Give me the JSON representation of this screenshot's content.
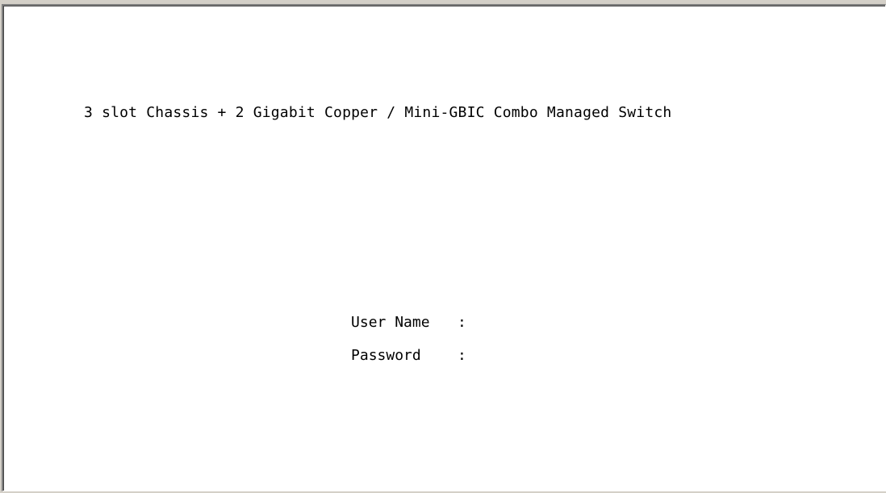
{
  "terminal": {
    "title": "3 slot Chassis + 2 Gigabit Copper / Mini-GBIC Combo Managed Switch",
    "login": {
      "username_label": "User Name",
      "username_sep": ":",
      "username_value": "",
      "password_label": "Password",
      "password_sep": ":",
      "password_value": ""
    }
  },
  "colors": {
    "background": "#ffffff",
    "text": "#000000",
    "frame": "#d4d0c8"
  }
}
